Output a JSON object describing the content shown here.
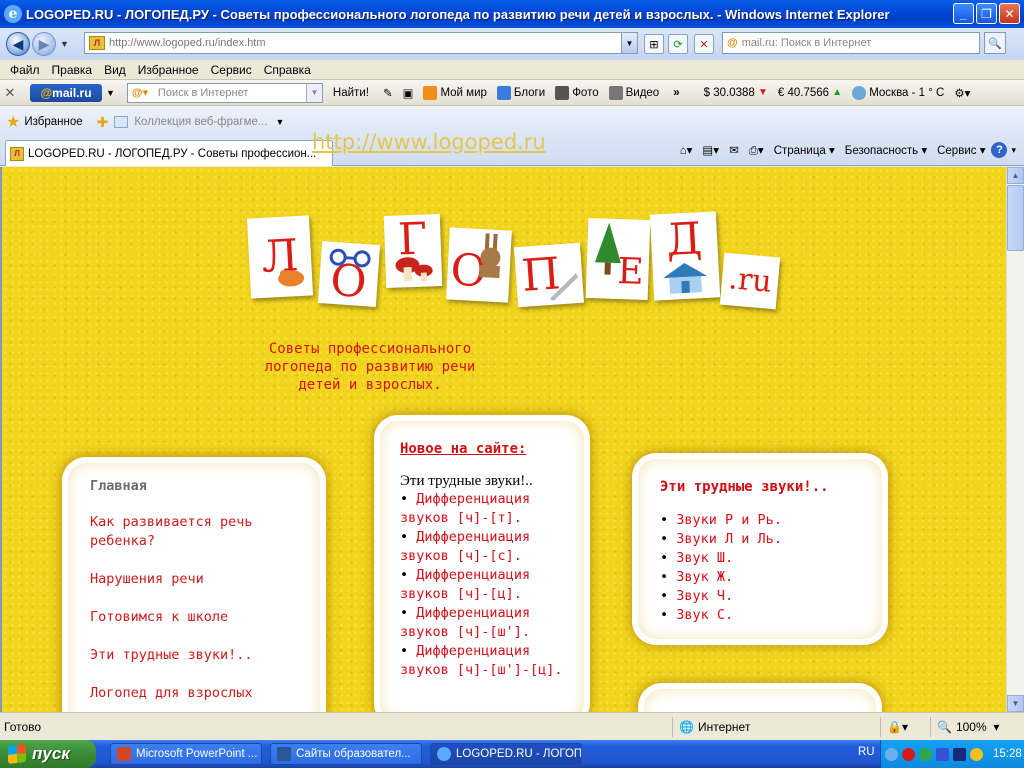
{
  "window": {
    "title": "LOGOPED.RU - ЛОГОПЕД.РУ - Советы профессионального логопеда по развитию речи детей и взрослых.  - Windows Internet Explorer"
  },
  "address_bar": {
    "url": "http://www.logoped.ru/index.htm",
    "search_placeholder": "mail.ru: Поиск в Интернет"
  },
  "menu": [
    "Файл",
    "Правка",
    "Вид",
    "Избранное",
    "Сервис",
    "Справка"
  ],
  "mail_toolbar": {
    "logo_at": "@",
    "logo_text": "mail.ru",
    "search_placeholder": "Поиск в Интернет",
    "find_label": "Найти!",
    "items": [
      "Мой мир",
      "Блоги",
      "Фото",
      "Видео"
    ],
    "usd": "$ 30.0388",
    "eur": "€ 40.7566",
    "weather": "Москва - 1 ° C"
  },
  "favorites_bar": {
    "favorites_label": "Избранное",
    "collection_label": "Коллекция веб-фрагме..."
  },
  "tab": {
    "label": "LOGOPED.RU - ЛОГОПЕД.РУ - Советы професcион..."
  },
  "overlay_url": "http://www.logoped.ru",
  "command_bar": {
    "page": "Страница",
    "safety": "Безопасность",
    "service": "Сервис"
  },
  "page": {
    "logo_letters": [
      "Л",
      "О",
      "Г",
      "О",
      "П",
      "Е",
      "Д"
    ],
    "logo_suffix": ".ru",
    "tagline": "Советы профессионального логопеда по развитию речи детей и взрослых.",
    "nav": {
      "current": "Главная",
      "links": [
        "Как развивается речь ребенка?",
        "Нарушения речи",
        "Готовимся к школе",
        "Эти трудные звуки!..",
        "Логопед для взрослых"
      ]
    },
    "news": {
      "heading": "Новое на сайте:",
      "subheading": "Эти трудные звуки!..",
      "items": [
        "Дифференциация звуков [ч]-[т].",
        "Дифференциация звуков [ч]-[с].",
        "Дифференциация звуков [ч]-[ц].",
        "Дифференциация звуков [ч]-[ш'].",
        "Дифференциация звуков [ч]-[ш']-[ц]."
      ]
    },
    "sounds": {
      "heading": "Эти трудные звуки!..",
      "items": [
        "Звуки Р и Рь.",
        "Звуки Л и Ль.",
        "Звук Ш.",
        "Звук Ж.",
        "Звук Ч.",
        "Звук С."
      ]
    }
  },
  "status_bar": {
    "status": "Готово",
    "zone": "Интернет",
    "zoom": "100%"
  },
  "taskbar": {
    "start": "пуск",
    "items": [
      "Microsoft PowerPoint ...",
      "Сайты образовател...",
      "LOGOPED.RU - ЛОГОП..."
    ],
    "lang": "RU",
    "time": "15:28"
  },
  "colors": {
    "page_background": "#f2d41a",
    "link_red": "#d6111a",
    "xp_blue": "#0048d8"
  }
}
